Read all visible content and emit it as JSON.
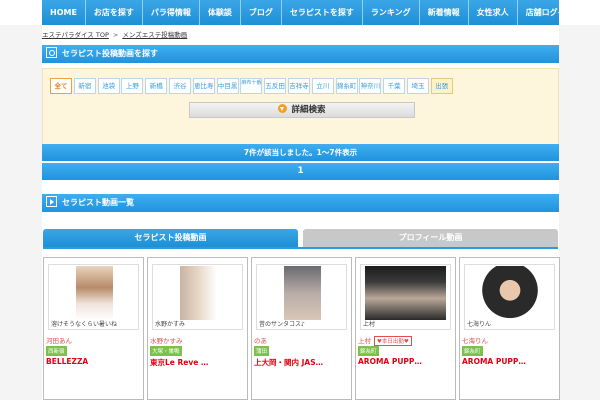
{
  "nav": {
    "items": [
      "HOME",
      "お店を探す",
      "パラ得情報",
      "体験談",
      "ブログ",
      "セラピストを探す",
      "ランキング",
      "新着情報",
      "女性求人",
      "店舗ログイン"
    ]
  },
  "breadcrumb": {
    "home": "エステパラダイス TOP",
    "separator": ">",
    "current": "メンズエステ投稿動画"
  },
  "search": {
    "title": "セラピスト投稿動画を探す",
    "areas": [
      "全て",
      "新宿",
      "池袋",
      "上野",
      "新橋",
      "渋谷",
      "恵比寿",
      "中目黒",
      "麻布十番",
      "五反田",
      "吉祥寺",
      "立川",
      "錦糸町",
      "神奈川",
      "千葉",
      "埼玉",
      "出張"
    ],
    "detail_button": "詳細検索"
  },
  "results": {
    "count_text": "7件が該当しました。1〜7件表示",
    "page": "1"
  },
  "videos": {
    "section_title": "セラピスト動画一覧",
    "tab_active": "セラピスト投稿動画",
    "tab_inactive": "プロフィール動画",
    "cards": [
      {
        "caption": "溶けそうなくらい暑いね",
        "name": "河田あん",
        "badge": "",
        "area": "西新宿",
        "shop": "BELLEZZA"
      },
      {
        "caption": "水野かすみ",
        "name": "水野かすみ",
        "badge": "",
        "area": "大塚・巣鴨",
        "shop": "東京Le Reve …"
      },
      {
        "caption": "昔のサンタコス♪",
        "name": "のあ",
        "badge": "",
        "area": "蒲田",
        "shop": "上大岡・関内 JAS…"
      },
      {
        "caption": "上村",
        "name": "上村",
        "badge": "♥本日出勤♥",
        "area": "錦糸町",
        "shop": "AROMA PUPP…"
      },
      {
        "caption": "七海りん",
        "name": "七海りん",
        "badge": "",
        "area": "錦糸町",
        "shop": "AROMA PUPP…"
      }
    ]
  },
  "colors": {
    "accent_blue": "#2b9be0",
    "panel_yellow": "#fdf6dc",
    "shop_red": "#e60012",
    "area_green": "#7cc24a"
  }
}
